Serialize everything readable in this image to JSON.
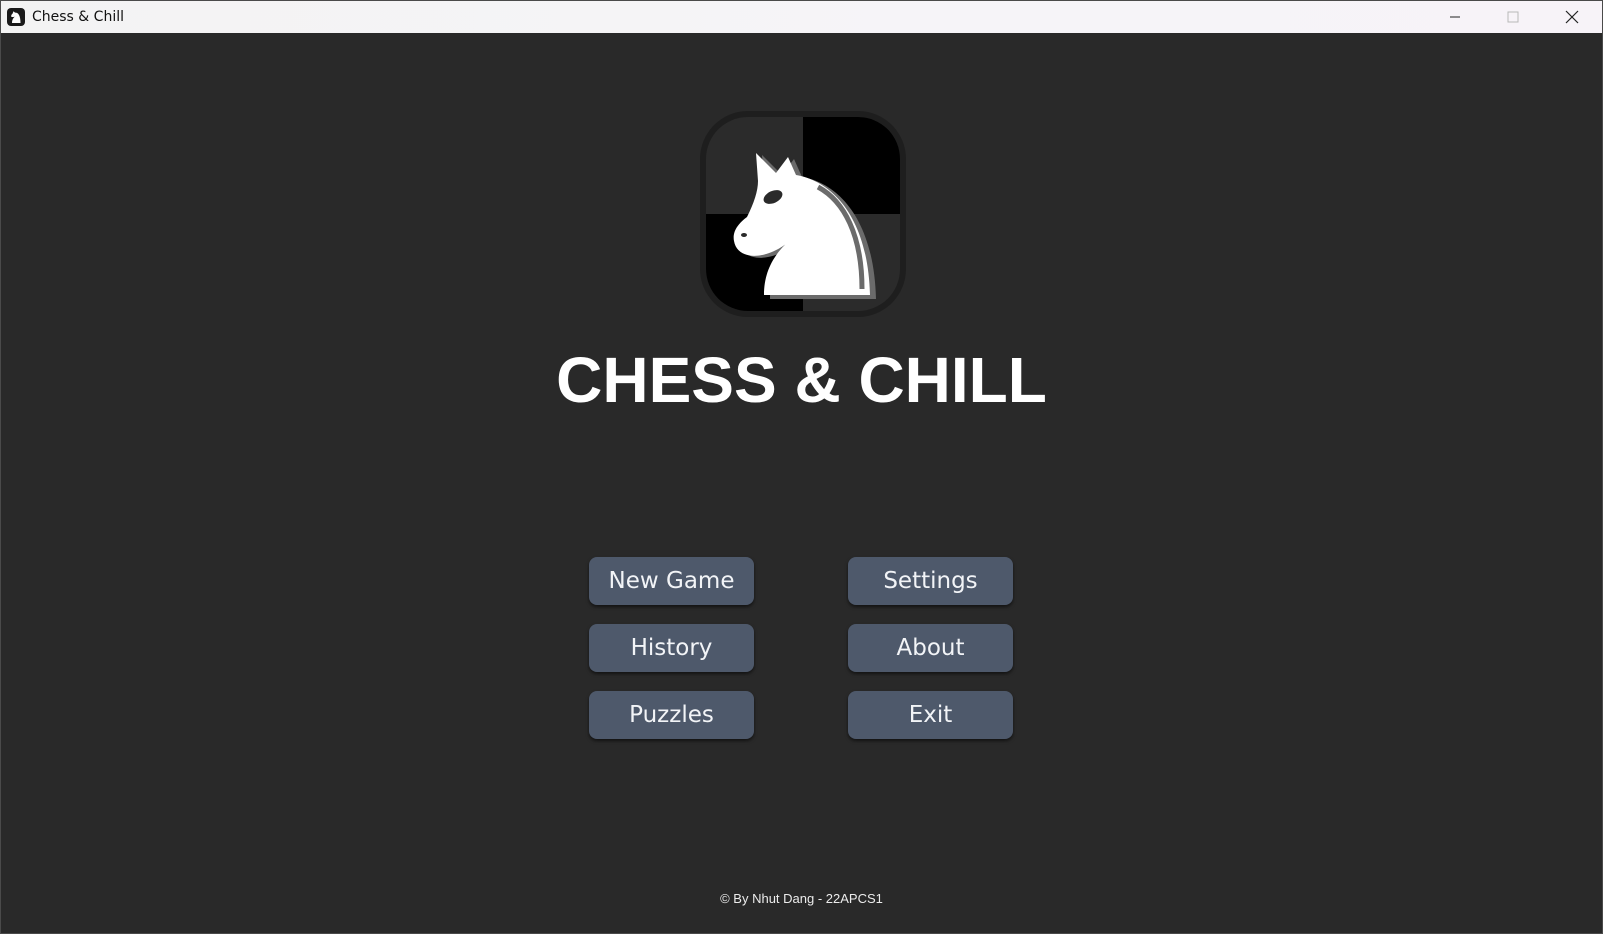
{
  "window": {
    "title": "Chess & Chill",
    "icon": "knight-icon",
    "controls": [
      "minimize-icon",
      "maximize-icon",
      "close-icon"
    ]
  },
  "main": {
    "logo": "knight-logo",
    "title": "CHESS & CHILL"
  },
  "menu": {
    "new_game": "New Game",
    "settings": "Settings",
    "history": "History",
    "about": "About",
    "puzzles": "Puzzles",
    "exit": "Exit"
  },
  "footer": {
    "credit": "© By Nhut Dang - 22APCS1"
  },
  "colors": {
    "background": "#292929",
    "button": "#4e596b",
    "button_text": "#f2f4f7",
    "title_text": "#ffffff"
  }
}
